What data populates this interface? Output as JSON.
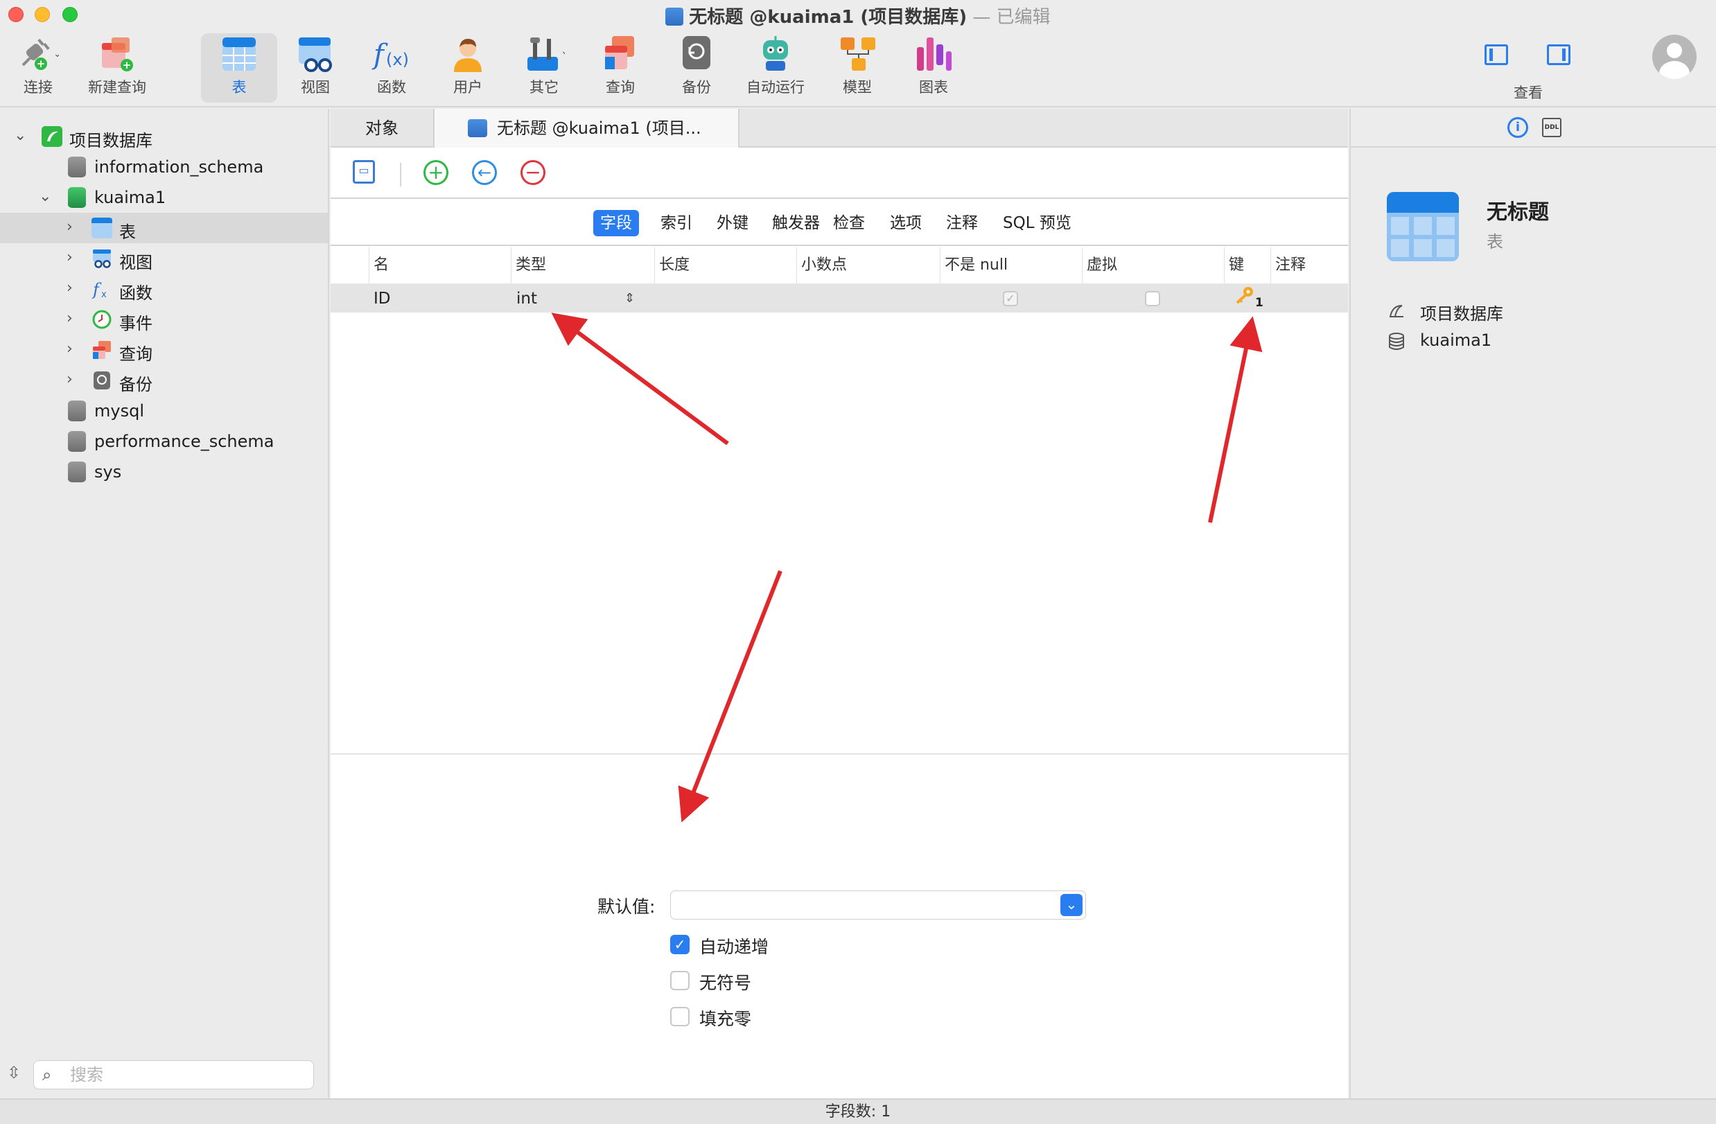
{
  "window": {
    "title": "无标题 @kuaima1 (项目数据库)",
    "edited": " — 已编辑"
  },
  "toolbar": {
    "connect": "连接",
    "new_query": "新建查询",
    "table": "表",
    "view": "视图",
    "function": "函数",
    "user": "用户",
    "other": "其它",
    "query": "查询",
    "backup": "备份",
    "automation": "自动运行",
    "model": "模型",
    "chart": "图表",
    "view_toggle": "查看"
  },
  "sidebar": {
    "connection": "项目数据库",
    "databases": [
      "information_schema",
      "kuaima1",
      "mysql",
      "performance_schema",
      "sys"
    ],
    "kuaima1_children": [
      "表",
      "视图",
      "函数",
      "事件",
      "查询",
      "备份"
    ],
    "search_placeholder": "搜索"
  },
  "tabs": {
    "objects": "对象",
    "current": "无标题 @kuaima1 (项目..."
  },
  "subtabs": [
    "字段",
    "索引",
    "外键",
    "触发器",
    "检查",
    "选项",
    "注释",
    "SQL 预览"
  ],
  "grid": {
    "headers": [
      "名",
      "类型",
      "长度",
      "小数点",
      "不是 null",
      "虚拟",
      "键",
      "注释"
    ],
    "rows": [
      {
        "name": "ID",
        "type": "int",
        "length": "",
        "decimals": "",
        "not_null": true,
        "virtual": false,
        "key": "1",
        "comment": ""
      }
    ]
  },
  "props": {
    "default_label": "默认值:",
    "default_value": "",
    "auto_increment": "自动递增",
    "unsigned": "无符号",
    "zerofill": "填充零"
  },
  "right_panel": {
    "title": "无标题",
    "subtitle": "表",
    "connection": "项目数据库",
    "database": "kuaima1",
    "ddl": "DDL"
  },
  "status": {
    "field_count": "字段数: 1"
  },
  "colors": {
    "accent": "#2a7df0",
    "arrow": "#e0272b"
  }
}
